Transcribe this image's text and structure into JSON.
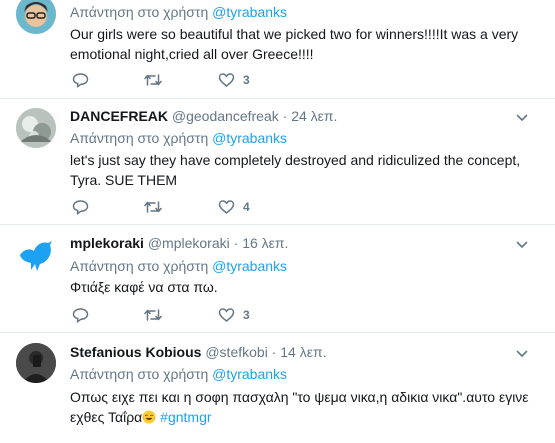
{
  "tweets": [
    {
      "name": "",
      "handle": "",
      "time": "",
      "reply_label": "Απάντηση στο χρήστη",
      "reply_to": "@tyrabanks",
      "text": "Our girls were so beautiful that we picked two for winners!!!!It was a very emotional night,cried all over Greece!!!!",
      "likes": "3"
    },
    {
      "name": "DANCEFREAK",
      "handle": "@geodancefreak",
      "time": "24 λεπ.",
      "reply_label": "Απάντηση στο χρήστη",
      "reply_to": "@tyrabanks",
      "text": "let's just say they have completely destroyed and ridiculized the concept, Tyra. SUE THEM",
      "likes": "4"
    },
    {
      "name": "mplekoraki",
      "handle": "@mplekoraki",
      "time": "16 λεπ.",
      "reply_label": "Απάντηση στο χρήστη",
      "reply_to": "@tyrabanks",
      "text": "Φτιάξε καφέ να στα πω.",
      "likes": "3"
    },
    {
      "name": "Stefanious Kobious",
      "handle": "@stefkobi",
      "time": "14 λεπ.",
      "reply_label": "Απάντηση στο χρήστη",
      "reply_to": "@tyrabanks",
      "text": "Οπως ειχε πει και η σοφη πασχαλη \"το ψεμα νικα,η αδικια νικα\".αυτο εγινε εχθες Ταΐρα",
      "hashtag": "#gntmgr",
      "likes": ""
    }
  ],
  "separator": "·",
  "icons": {
    "reply": "reply-icon",
    "retweet": "retweet-icon",
    "like": "heart-icon",
    "more": "chevron-down-icon",
    "emoji": "joy-emoji-icon"
  },
  "colors": {
    "link": "#1da1f2",
    "muted": "#657786",
    "text": "#14171a",
    "border": "#e6ecf0"
  }
}
